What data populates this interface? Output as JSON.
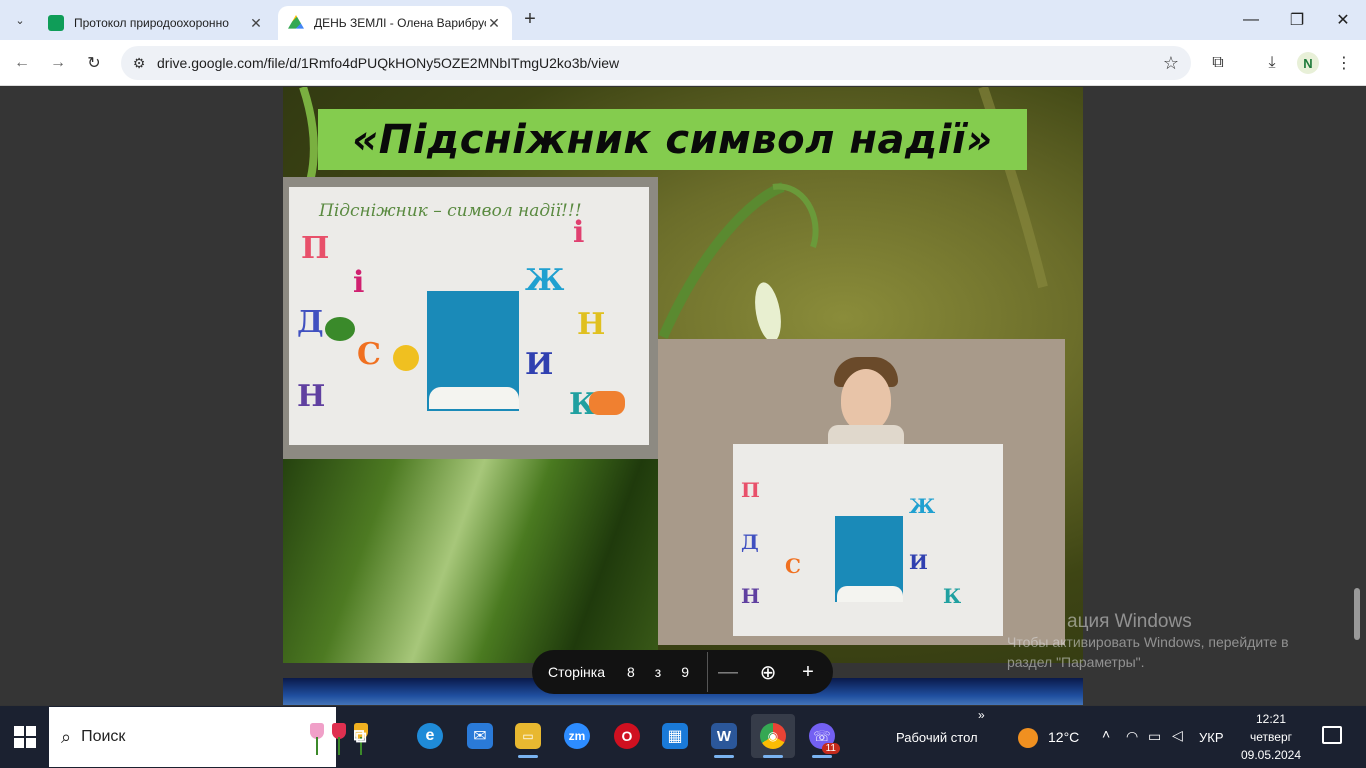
{
  "tabs": [
    {
      "title": "Протокол природоохоронно",
      "favicon": "sheets-icon",
      "color": "#0f9d58"
    },
    {
      "title": "ДЕНЬ ЗЕМЛІ - Олена Варибрус",
      "favicon": "drive-icon",
      "color": "#4285f4"
    }
  ],
  "window": {
    "minimize": "—",
    "restore": "❐",
    "close": "✕",
    "new_tab": "+",
    "tab_menu": "⌄"
  },
  "toolbar": {
    "url": "drive.google.com/file/d/1Rmfo4dPUQkHONy5OZE2MNbITmgU2ko3b/view",
    "back": "←",
    "forward": "→",
    "reload": "↻",
    "star": "☆",
    "extensions": "⧉",
    "download": "⤓",
    "profile_initial": "N",
    "menu": "⋮"
  },
  "slide": {
    "title": "«Підсніжник символ надії»",
    "poster_heading": "Підсніжник – символ надії!!!",
    "letters": [
      {
        "char": "П",
        "color": "#e8506a"
      },
      {
        "char": "і",
        "color": "#d02070"
      },
      {
        "char": "Д",
        "color": "#4050c0"
      },
      {
        "char": "С",
        "color": "#f07020"
      },
      {
        "char": "Н",
        "color": "#6040a0"
      },
      {
        "char": "і",
        "color": "#e04070"
      },
      {
        "char": "Ж",
        "color": "#20a0d0"
      },
      {
        "char": "Н",
        "color": "#e0c020"
      },
      {
        "char": "И",
        "color": "#3040b0"
      },
      {
        "char": "К",
        "color": "#20a0a0"
      }
    ]
  },
  "pager": {
    "label": "Сторінка",
    "current": "8",
    "of": "з",
    "total": "9",
    "zoom_out": "—",
    "zoom": "⊕",
    "zoom_in": "+"
  },
  "watermark": {
    "title": "ация Windows",
    "line1": "Чтобы активировать Windows, перейдите в",
    "line2": "раздел \"Параметры\"."
  },
  "taskbar": {
    "search_placeholder": "Поиск",
    "desktop_label": "Рабочий стол",
    "temperature": "12°C",
    "language": "УКР",
    "time": "12:21",
    "day": "четверг",
    "date": "09.05.2024",
    "viber_badge": "11",
    "apps": [
      {
        "name": "task-view-icon",
        "label": "⧉"
      },
      {
        "name": "edge-icon",
        "label": "e",
        "color": "#1f8bd8"
      },
      {
        "name": "mail-icon",
        "label": "✉",
        "color": "#2a7ad8"
      },
      {
        "name": "file-explorer-icon",
        "label": "▭",
        "color": "#e8b830"
      },
      {
        "name": "zoom-icon",
        "label": "zm",
        "color": "#2d8cff"
      },
      {
        "name": "opera-icon",
        "label": "O",
        "color": "#d01020"
      },
      {
        "name": "store-icon",
        "label": "▦",
        "color": "#1a7ad8"
      },
      {
        "name": "word-icon",
        "label": "W",
        "color": "#2b579a"
      },
      {
        "name": "chrome-icon",
        "label": "◉",
        "color": "#34a853"
      },
      {
        "name": "viber-icon",
        "label": "☏",
        "color": "#7360f2"
      }
    ]
  }
}
